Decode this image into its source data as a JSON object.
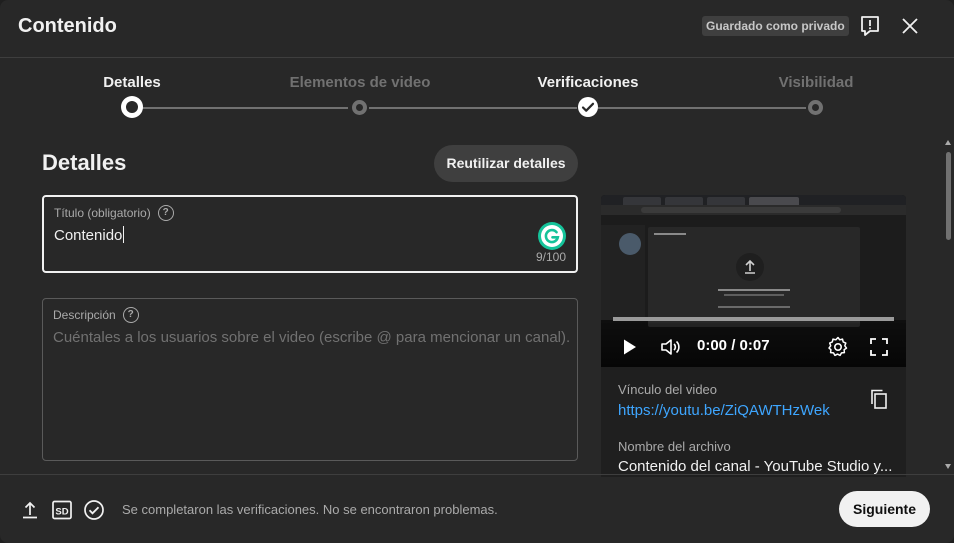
{
  "header": {
    "title": "Contenido",
    "saved_badge": "Guardado como privado",
    "feedback_icon": "feedback-icon",
    "close_icon": "close-icon"
  },
  "stepper": {
    "steps": [
      {
        "label": "Detalles",
        "state": "current"
      },
      {
        "label": "Elementos de video",
        "state": "pending"
      },
      {
        "label": "Verificaciones",
        "state": "done"
      },
      {
        "label": "Visibilidad",
        "state": "pending"
      }
    ]
  },
  "details": {
    "section_title": "Detalles",
    "reuse_button": "Reutilizar detalles",
    "title_field": {
      "label": "Título (obligatorio)",
      "value": "Contenido",
      "counter": "9/100"
    },
    "description_field": {
      "label": "Descripción",
      "placeholder": "Cuéntales a los usuarios sobre el video (escribe @ para mencionar un canal)."
    }
  },
  "preview": {
    "time": "0:00 / 0:07",
    "video_link_label": "Vínculo del video",
    "video_link": "https://youtu.be/ZiQAWTHzWek",
    "file_name_label": "Nombre del archivo",
    "file_name": "Contenido del canal - YouTube Studio y..."
  },
  "footer": {
    "status": "Se completaron las verificaciones. No se encontraron problemas.",
    "next_button": "Siguiente",
    "icons": [
      "upload-icon",
      "sd-icon",
      "check-circle-icon"
    ]
  },
  "colors": {
    "background": "#282828",
    "accent_link": "#3ea6ff",
    "active_text": "#f1f1f1",
    "inactive_text": "#717171",
    "grammarly": "#15c39a"
  }
}
